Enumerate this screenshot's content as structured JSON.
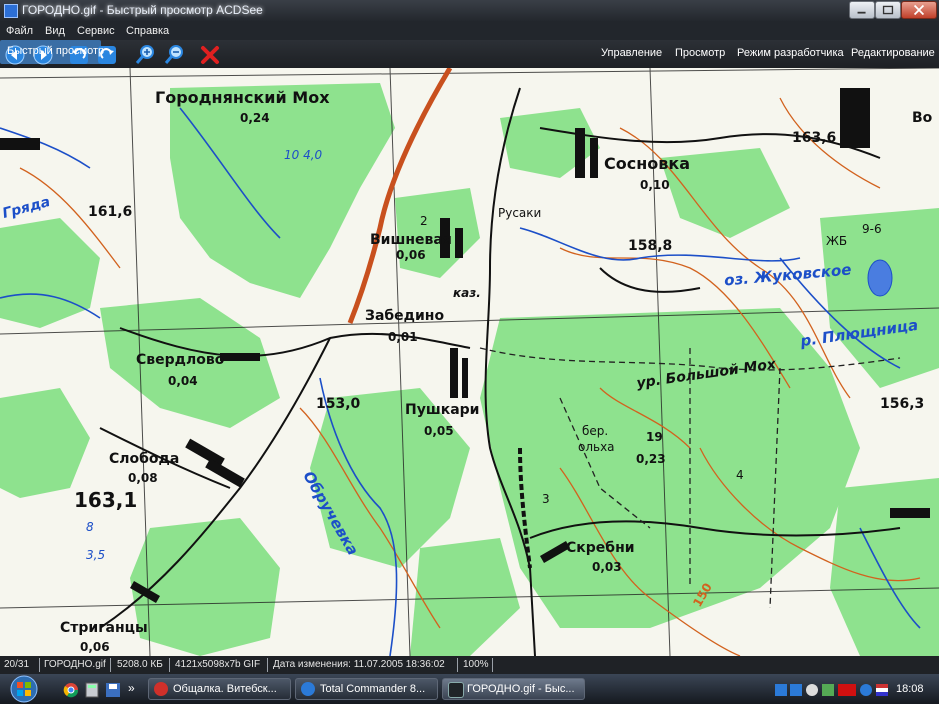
{
  "window": {
    "title": "ГОРОДНО.gif - Быстрый просмотр ACDSee"
  },
  "menu": [
    "Файл",
    "Вид",
    "Сервис",
    "Справка"
  ],
  "toolbar": {
    "buttons": [
      "back-icon",
      "forward-icon",
      "rotate-left-icon",
      "rotate-right-icon",
      "zoom-in-icon",
      "zoom-out-icon",
      "close-x-icon"
    ],
    "modes": {
      "quick_view": "Быстрый просмотр",
      "manage": "Управление",
      "view": "Просмотр",
      "developer": "Режим разработчика",
      "edit": "Редактирование"
    },
    "active_mode": "Быстрый просмотр",
    "accent": "#3a6ea5"
  },
  "map": {
    "labels": {
      "gorodnyanskiy": "Городнянский Мох",
      "gorodnyanskiy_val": "0,24",
      "sosnovka": "Сосновка",
      "sosnovka_val": "0,10",
      "vishnevaya": "Вишневая",
      "vishnevaya_val": "0,06",
      "kaz": "каз.",
      "rusaki": "Русаки",
      "zabedino": "Забедино",
      "zabedino_val": "0,01",
      "sverdlovo": "Свердлово",
      "sverdlovo_val": "0,04",
      "pushkari": "Пушкари",
      "pushkari_val": "0,05",
      "sloboda": "Слобода",
      "sloboda_val": "0,08",
      "skrebni": "Скребни",
      "skrebni_val": "0,03",
      "striganty": "Стриганцы",
      "striganty_val": "0,06",
      "gryada": "Гряда",
      "h161": "161,6",
      "h153": "153,0",
      "h163": "163,1",
      "h158": "158,8",
      "h1636": "163,6",
      "h1563": "156,3",
      "bolshoy_mokh": "ур. Большой Мох",
      "ber": "бер.",
      "olkha": "ольха",
      "val19": "19",
      "val023": "0,23",
      "zhukovskoe": "оз. Жуковское",
      "plyushnitsa": "р. Плющница",
      "obruchevka": "Обручевка",
      "vo": "Во",
      "zhb": "ЖБ",
      "val150": "150",
      "val104": "10 4,0",
      "val96": "9-6",
      "val8": "8",
      "val35": "3,5",
      "val3": "3",
      "val2": "2",
      "val4": "4"
    },
    "colors": {
      "forest": "#8ee28e",
      "water": "#1c4fc8",
      "contour": "#d2621e",
      "road": "#c8501e"
    }
  },
  "status": {
    "position": "20/31",
    "filename": "ГОРОДНО.gif",
    "filesize": "5208.0 КБ",
    "dimensions": "4121x5098x7b GIF",
    "modified": "Дата изменения: 11.07.2005 18:36:02",
    "zoom": "100%"
  },
  "taskbar": {
    "tasks": [
      {
        "label": "Общалка. Витебск...",
        "icon": "opera-icon"
      },
      {
        "label": "Total Commander 8...",
        "icon": "total-commander-icon"
      },
      {
        "label": "ГОРОДНО.gif - Быс...",
        "icon": "acdsee-icon"
      }
    ],
    "quicklaunch_more": "»",
    "clock": "18:08"
  }
}
